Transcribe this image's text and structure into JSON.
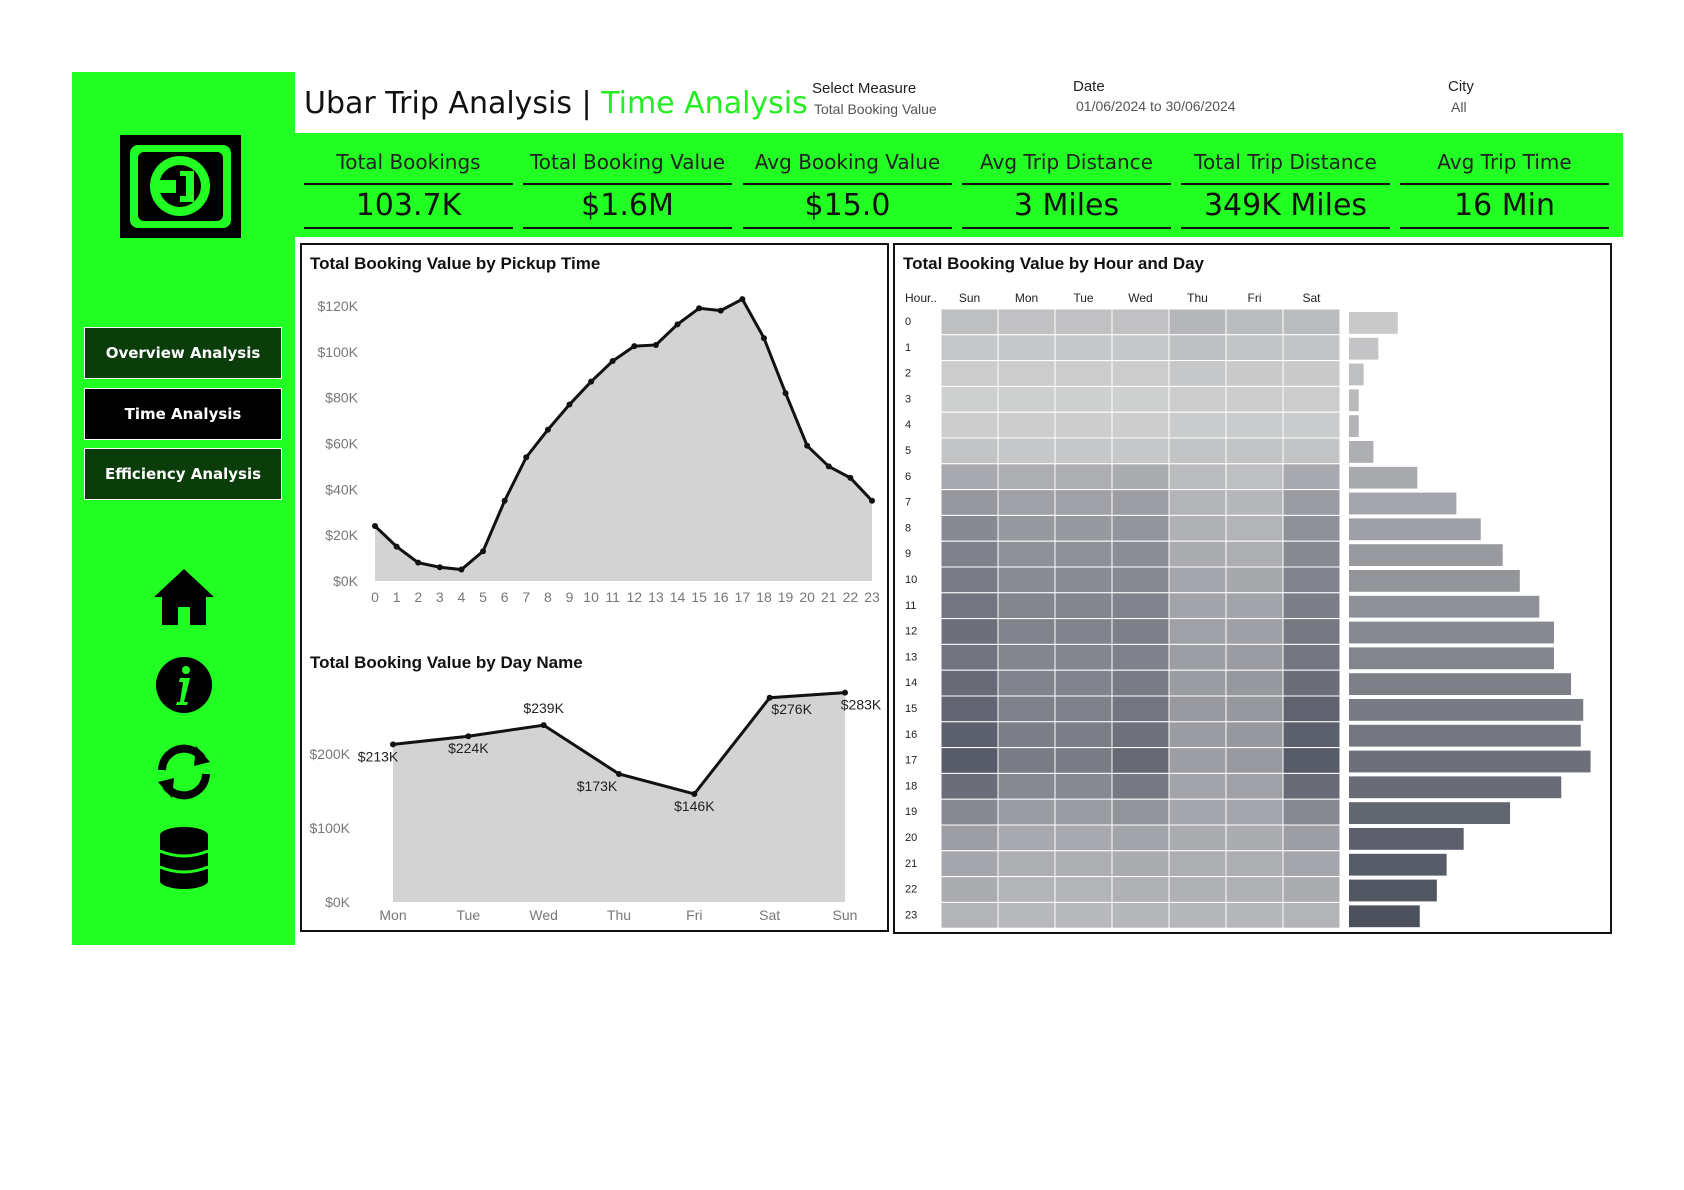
{
  "header": {
    "title_main": "Ubar Trip Analysis | ",
    "title_accent": "Time Analysis"
  },
  "filters": {
    "measure_label": "Select Measure",
    "measure_value": "Total Booking Value",
    "date_label": "Date",
    "date_value": "01/06/2024 to 30/06/2024",
    "city_label": "City",
    "city_value": "All"
  },
  "nav": {
    "overview": "Overview Analysis",
    "time": "Time Analysis",
    "efficiency": "Efficiency Analysis"
  },
  "icons": [
    "uber-logo-icon",
    "home-icon",
    "info-icon",
    "refresh-icon",
    "database-icon"
  ],
  "colors": {
    "accent": "#22ff22",
    "dark_green": "#0b3d0b",
    "area_fill": "#d3d3d3"
  },
  "kpis": [
    {
      "label": "Total Bookings",
      "value": "103.7K"
    },
    {
      "label": "Total Booking Value",
      "value": "$1.6M"
    },
    {
      "label": "Avg Booking Value",
      "value": "$15.0"
    },
    {
      "label": "Avg Trip Distance",
      "value": "3 Miles"
    },
    {
      "label": "Total Trip Distance",
      "value": "349K Miles"
    },
    {
      "label": "Avg Trip Time",
      "value": "16 Min"
    }
  ],
  "chart_data": [
    {
      "type": "area",
      "title": "Total Booking Value by  Pickup Time",
      "x": [
        0,
        1,
        2,
        3,
        4,
        5,
        6,
        7,
        8,
        9,
        10,
        11,
        12,
        13,
        14,
        15,
        16,
        17,
        18,
        19,
        20,
        21,
        22,
        23
      ],
      "values": [
        24000,
        15000,
        8000,
        6000,
        5000,
        13000,
        35000,
        54000,
        66000,
        77000,
        87000,
        96000,
        102500,
        103000,
        112000,
        119000,
        118000,
        123000,
        106000,
        82000,
        59000,
        50000,
        45000,
        35000
      ],
      "ylim": [
        0,
        120000
      ],
      "yticks": [
        "$0K",
        "$20K",
        "$40K",
        "$60K",
        "$80K",
        "$100K",
        "$120K"
      ]
    },
    {
      "type": "area",
      "title": "Total Booking Value by Day Name",
      "categories": [
        "Mon",
        "Tue",
        "Wed",
        "Thu",
        "Fri",
        "Sat",
        "Sun"
      ],
      "values": [
        213000,
        224000,
        239000,
        173000,
        146000,
        276000,
        283000
      ],
      "data_labels": [
        "$213K",
        "$224K",
        "$239K",
        "$173K",
        "$146K",
        "$276K",
        "$283K"
      ],
      "ylim": [
        0,
        300000
      ],
      "yticks": [
        "$0K",
        "$100K",
        "$200K"
      ]
    },
    {
      "type": "heatmap",
      "title": "Total Booking Value by Hour and Day",
      "hour_header": "Hour..",
      "days": [
        "Sun",
        "Mon",
        "Tue",
        "Wed",
        "Thu",
        "Fri",
        "Sat"
      ],
      "hours": [
        "0",
        "1",
        "2",
        "3",
        "4",
        "5",
        "6",
        "7",
        "8",
        "9",
        "10",
        "11",
        "12",
        "13",
        "14",
        "15",
        "16",
        "17",
        "18",
        "19",
        "20",
        "21",
        "22",
        "23"
      ],
      "matrix": [
        [
          0.16,
          0.14,
          0.14,
          0.14,
          0.22,
          0.18,
          0.18
        ],
        [
          0.1,
          0.1,
          0.1,
          0.1,
          0.15,
          0.12,
          0.12
        ],
        [
          0.06,
          0.06,
          0.06,
          0.06,
          0.1,
          0.08,
          0.08
        ],
        [
          0.04,
          0.04,
          0.04,
          0.04,
          0.06,
          0.06,
          0.06
        ],
        [
          0.05,
          0.05,
          0.05,
          0.05,
          0.07,
          0.07,
          0.07
        ],
        [
          0.12,
          0.1,
          0.1,
          0.1,
          0.12,
          0.12,
          0.12
        ],
        [
          0.32,
          0.28,
          0.28,
          0.3,
          0.18,
          0.16,
          0.32
        ],
        [
          0.45,
          0.38,
          0.38,
          0.4,
          0.24,
          0.22,
          0.42
        ],
        [
          0.55,
          0.44,
          0.44,
          0.47,
          0.26,
          0.24,
          0.5
        ],
        [
          0.62,
          0.5,
          0.5,
          0.52,
          0.3,
          0.28,
          0.56
        ],
        [
          0.66,
          0.54,
          0.54,
          0.56,
          0.34,
          0.33,
          0.6
        ],
        [
          0.7,
          0.58,
          0.58,
          0.6,
          0.36,
          0.36,
          0.64
        ],
        [
          0.75,
          0.6,
          0.6,
          0.63,
          0.38,
          0.39,
          0.68
        ],
        [
          0.72,
          0.58,
          0.58,
          0.62,
          0.4,
          0.42,
          0.7
        ],
        [
          0.78,
          0.6,
          0.6,
          0.66,
          0.42,
          0.44,
          0.76
        ],
        [
          0.82,
          0.62,
          0.62,
          0.7,
          0.43,
          0.45,
          0.84
        ],
        [
          0.86,
          0.64,
          0.64,
          0.74,
          0.42,
          0.44,
          0.86
        ],
        [
          0.9,
          0.66,
          0.66,
          0.8,
          0.4,
          0.43,
          0.9
        ],
        [
          0.76,
          0.56,
          0.56,
          0.68,
          0.36,
          0.38,
          0.78
        ],
        [
          0.55,
          0.42,
          0.42,
          0.48,
          0.34,
          0.34,
          0.56
        ],
        [
          0.4,
          0.32,
          0.32,
          0.36,
          0.3,
          0.3,
          0.4
        ],
        [
          0.34,
          0.28,
          0.28,
          0.3,
          0.28,
          0.28,
          0.34
        ],
        [
          0.3,
          0.24,
          0.24,
          0.26,
          0.26,
          0.26,
          0.3
        ],
        [
          0.24,
          0.2,
          0.2,
          0.22,
          0.22,
          0.22,
          0.24
        ]
      ]
    },
    {
      "type": "bar",
      "orientation": "horizontal",
      "categories": [
        "0",
        "1",
        "2",
        "3",
        "4",
        "5",
        "6",
        "7",
        "8",
        "9",
        "10",
        "11",
        "12",
        "13",
        "14",
        "15",
        "16",
        "17",
        "18",
        "19",
        "20",
        "21",
        "22",
        "23"
      ],
      "values": [
        20,
        12,
        6,
        4,
        4,
        10,
        28,
        44,
        54,
        63,
        70,
        78,
        84,
        84,
        91,
        96,
        95,
        99,
        87,
        66,
        47,
        40,
        36,
        29
      ]
    }
  ]
}
